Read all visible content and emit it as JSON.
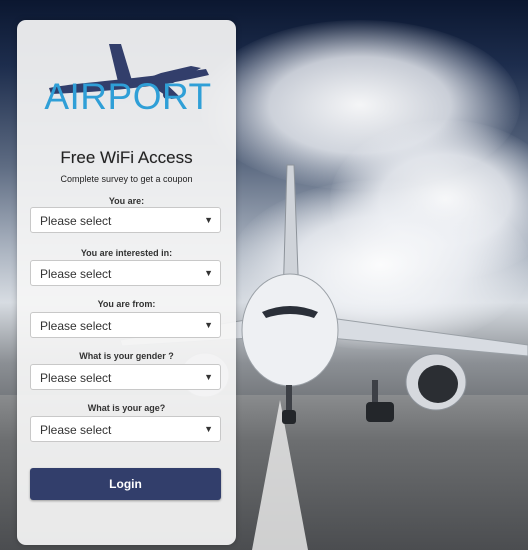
{
  "brand": {
    "logo_text": "AIRPORT",
    "logo_color": "#2f9fd7",
    "plane_color": "#323e6b"
  },
  "heading": {
    "title": "Free WiFi Access",
    "subtitle": "Complete survey to get a coupon"
  },
  "form": {
    "fields": [
      {
        "label": "You are:",
        "value": "Please select"
      },
      {
        "label": "You are interested in:",
        "value": "Please select"
      },
      {
        "label": "You are from:",
        "value": "Please select"
      },
      {
        "label": "What is your gender ?",
        "value": "Please select"
      },
      {
        "label": "What is your age?",
        "value": "Please select"
      }
    ],
    "login_label": "Login",
    "login_color": "#323e6b"
  },
  "icons": {
    "dropdown": "▼"
  }
}
